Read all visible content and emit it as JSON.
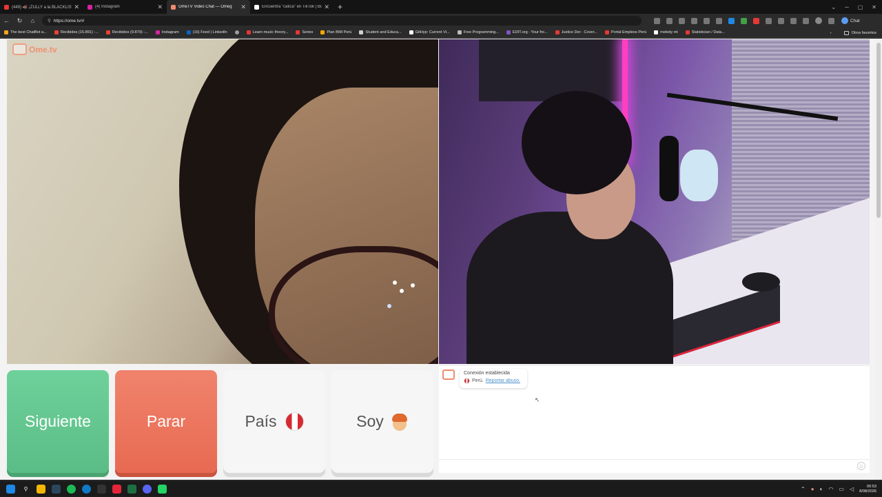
{
  "browser": {
    "tabs": [
      {
        "label": "(449) 🐗 ¡ZULLY a la BLACKLIST! ❌",
        "color": "#e53935",
        "active": false
      },
      {
        "label": "(4) Instagram",
        "color": "#d6249f",
        "active": false
      },
      {
        "label": "OmeTV Video Chat — Omeg",
        "color": "#f08a6f",
        "active": true
      },
      {
        "label": "Encuentra \"catica\" en TikTok | Busc",
        "color": "#ffffff",
        "active": false
      }
    ],
    "url": "https://ome.tv/#",
    "chat_label": "Chat",
    "bookmarks": [
      {
        "label": "The best ChatBot a...",
        "color": "#f5a623"
      },
      {
        "label": "Recibidos (15.891) -...",
        "color": "#ea4335"
      },
      {
        "label": "Recibidos (9.879) -...",
        "color": "#ea4335"
      },
      {
        "label": "Instagram",
        "color": "#d6249f"
      },
      {
        "label": "(16) Feed | LinkedIn",
        "color": "#0a66c2"
      },
      {
        "label": "",
        "color": "#9e9e9e"
      },
      {
        "label": "Learn music theory...",
        "color": "#e53935"
      },
      {
        "label": "Series",
        "color": "#e53935"
      },
      {
        "label": "Plan BIM Perú",
        "color": "#f2a900"
      },
      {
        "label": "Student and Educa...",
        "color": "#cfcfcf"
      },
      {
        "label": "GitHyp: Current Vi...",
        "color": "#ffffff"
      },
      {
        "label": "Free Programming...",
        "color": "#bdbdbd"
      },
      {
        "label": "EDIT.org - Your fre...",
        "color": "#7e57c2"
      },
      {
        "label": "Justice Der - Cover...",
        "color": "#e53935"
      },
      {
        "label": "Portal Empleos Perú",
        "color": "#e53935"
      },
      {
        "label": "melody ml",
        "color": "#ffffff"
      },
      {
        "label": "Statistician / Data...",
        "color": "#e53935"
      }
    ],
    "bookmarks_other": "Otros favoritos"
  },
  "page": {
    "logo": "Ome.tv",
    "buttons": {
      "next": "Siguiente",
      "stop": "Parar",
      "country": "País",
      "gender": "Soy"
    },
    "chat": {
      "status": "Conexión establecida",
      "country": "Perú.",
      "report": "Reportar abuso."
    }
  },
  "taskbar": {
    "time": "00:53",
    "date": "8/08/2026"
  }
}
